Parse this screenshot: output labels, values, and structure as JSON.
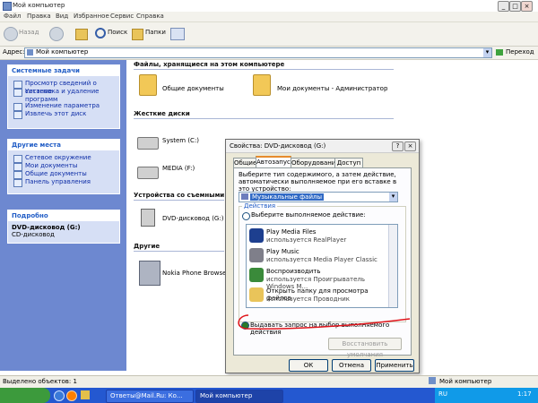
{
  "window": {
    "title": "Мой компьютер",
    "minimize": "_",
    "maximize": "□",
    "close": "×"
  },
  "menu": [
    "Файл",
    "Правка",
    "Вид",
    "Избранное",
    "Сервис",
    "Справка"
  ],
  "toolbar": {
    "back": "Назад",
    "search": "Поиск",
    "folders": "Папки"
  },
  "address": {
    "label": "Адрес:",
    "value": "Мой компьютер",
    "go": "Переход"
  },
  "sidebar": {
    "system_tasks": {
      "title": "Системные задачи",
      "items": [
        "Просмотр сведений о системе",
        "Установка и удаление программ",
        "Изменение параметра",
        "Извлечь этот диск"
      ]
    },
    "other_places": {
      "title": "Другие места",
      "items": [
        "Сетевое окружение",
        "Мои документы",
        "Общие документы",
        "Панель управления"
      ]
    },
    "details": {
      "title": "Подробно",
      "name": "DVD-дисковод (G:)",
      "type": "CD-дисковод"
    }
  },
  "content": {
    "files_header": "Файлы, хранящиеся на этом компьютере",
    "folders": [
      "Общие документы",
      "Мои документы - Администратор"
    ],
    "hdd_header": "Жесткие диски",
    "drives": [
      "System (C:)",
      "MEDIA (F:)"
    ],
    "removable_header": "Устройства со съемными носителями",
    "removable": [
      "DVD-дисковод (G:)"
    ],
    "other_header": "Другие",
    "other": [
      "Nokia Phone Browser"
    ]
  },
  "dialog": {
    "title": "Свойства: DVD-дисковод (G:)",
    "help": "?",
    "close": "×",
    "tabs": [
      "Общие",
      "Автозапуск",
      "Оборудование",
      "Доступ"
    ],
    "description": "Выберите тип содержимого, а затем действие, автоматически выполняемое при его вставке в это устройство:",
    "content_type": "Музыкальные файлы",
    "actions_label": "Действия",
    "select_action": "Выберите выполняемое действие:",
    "actions": [
      {
        "title": "Play Media Files",
        "sub": "используется RealPlayer"
      },
      {
        "title": "Play Music",
        "sub": "используется Media Player Classic"
      },
      {
        "title": "Воспроизводить",
        "sub": "используется Проигрыватель Windows M..."
      },
      {
        "title": "Открыть папку для просмотра файлов",
        "sub": "используется Проводник"
      }
    ],
    "prompt_option": "Выдавать запрос на выбор выполняемого действия",
    "restore": "Восстановить умолчания",
    "ok": "ОК",
    "cancel": "Отмена",
    "apply": "Применить"
  },
  "status": {
    "selected": "Выделено объектов: 1",
    "zone": "Мой компьютер"
  },
  "taskbar": {
    "tasks": [
      "Ответы@Mail.Ru: Ко...",
      "Мой компьютер"
    ],
    "clock": "1:17",
    "lang": "RU"
  }
}
